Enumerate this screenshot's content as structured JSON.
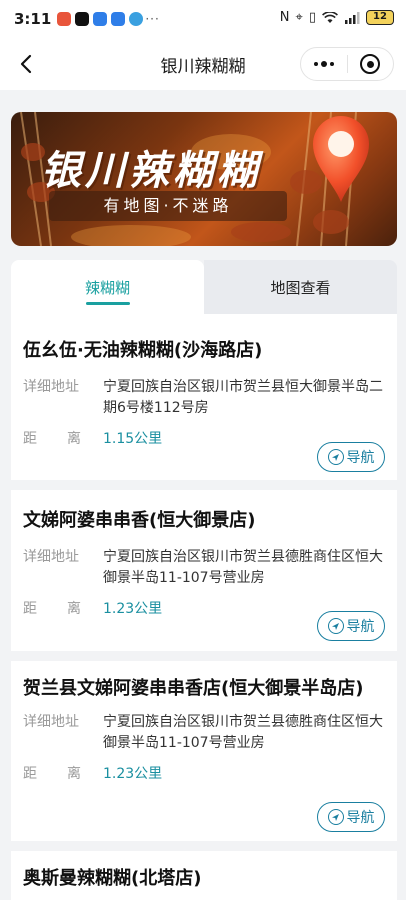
{
  "status_bar": {
    "time": "3:11",
    "more": "···",
    "battery": "12"
  },
  "nav": {
    "title": "银川辣糊糊"
  },
  "banner": {
    "title": "银川辣糊糊",
    "slogan": "有地图·不迷路"
  },
  "tabs": [
    {
      "label": "辣糊糊"
    },
    {
      "label": "地图查看"
    }
  ],
  "labels": {
    "address": "详细地址",
    "distance_a": "距",
    "distance_b": "离",
    "navigate": "导航"
  },
  "stores": [
    {
      "name": "伍幺伍·无油辣糊糊(沙海路店)",
      "address": "宁夏回族自治区银川市贺兰县恒大御景半岛二期6号楼112号房",
      "distance": "1.15公里"
    },
    {
      "name": "文娣阿婆串串香(恒大御景店)",
      "address": "宁夏回族自治区银川市贺兰县德胜商住区恒大御景半岛11-107号营业房",
      "distance": "1.23公里"
    },
    {
      "name": "贺兰县文娣阿婆串串香店(恒大御景半岛店)",
      "address": "宁夏回族自治区银川市贺兰县德胜商住区恒大御景半岛11-107号营业房",
      "distance": "1.23公里"
    },
    {
      "name": "奥斯曼辣糊糊(北塔店)"
    }
  ],
  "colors": {
    "accent": "#1aa0a0",
    "nav_button": "#1a7fa0",
    "banner": "#c2561a"
  }
}
